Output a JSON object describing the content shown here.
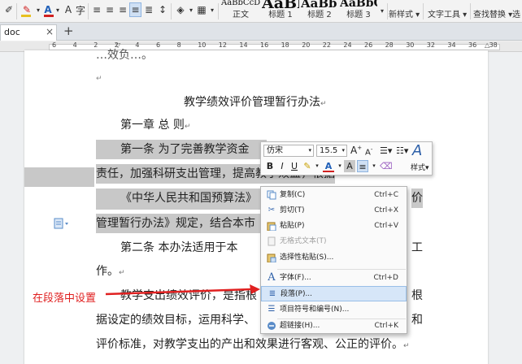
{
  "ribbon": {
    "styles": [
      {
        "preview": "AaBbCcDd",
        "label": "正文"
      },
      {
        "preview": "AaBl",
        "label": "标题 1"
      },
      {
        "preview": "AaBb(",
        "label": "标题 2"
      },
      {
        "preview": "AaBbC",
        "label": "标题 3"
      }
    ],
    "new_style_label": "新样式",
    "text_tools_label": "文字工具",
    "find_replace_label": "查找替换",
    "select_label": "选择",
    "underline_color": "#d02020",
    "font_color": "#1f5fb8"
  },
  "tabbar": {
    "tab_label": "doc",
    "add_label": "+",
    "close_label": "×"
  },
  "ruler": {
    "numbers": [
      "6",
      "4",
      "2",
      "2",
      "4",
      "6",
      "8",
      "10",
      "12",
      "14",
      "16",
      "18",
      "20",
      "22",
      "24",
      "26",
      "28",
      "30",
      "32",
      "34",
      "36",
      "38"
    ]
  },
  "document": {
    "top_partial": "…效负…。",
    "title": "教学绩效评价管理暂行办法",
    "chapter": "第一章    总    则",
    "p1_a": "第一条    为了完善教学资金",
    "p1_b": "责任，加强科研支出管理，提高教学效益，根据",
    "p1_c_left": "《中华人民共和国预算法》",
    "p1_c_right": "价",
    "p1_d": "管理暂行办法》规定，结合本市",
    "p2_a_left": "第二条    本办法适用于本",
    "p2_a_right": "工",
    "p2_b": "作。",
    "p3_a_left": "教学支出绩效评价，是指根",
    "p3_a_right": "根",
    "p3_b_left": "据设定的绩效目标，运用科学、",
    "p3_b_right": "和",
    "p3_c": "评价标准，对教学支出的产出和效果进行客观、公正的评价。",
    "para_mark": "↵",
    "highlight_color": "#c8c8c8"
  },
  "mini_toolbar": {
    "font_name": "仿宋",
    "font_size": "15.5",
    "grow_label": "A",
    "shrink_label": "A",
    "styles_label": "样式",
    "bold": "B",
    "italic": "I",
    "underline": "U",
    "font_color_label": "A",
    "char_shade_label": "A"
  },
  "context_menu": {
    "items": [
      {
        "icon": "copy-icon",
        "label": "复制(C)",
        "shortcut": "Ctrl+C",
        "disabled": false,
        "selected": false
      },
      {
        "icon": "cut-icon",
        "label": "剪切(T)",
        "shortcut": "Ctrl+X",
        "disabled": false,
        "selected": false
      },
      {
        "icon": "paste-icon",
        "label": "粘贴(P)",
        "shortcut": "Ctrl+V",
        "disabled": false,
        "selected": false
      },
      {
        "icon": "plain-text-icon",
        "label": "无格式文本(T)",
        "shortcut": "",
        "disabled": true,
        "selected": false
      },
      {
        "icon": "paste-special-icon",
        "label": "选择性粘贴(S)...",
        "shortcut": "",
        "disabled": false,
        "selected": false
      },
      {
        "icon": "font-icon",
        "label": "字体(F)...",
        "shortcut": "Ctrl+D",
        "disabled": false,
        "selected": false
      },
      {
        "icon": "paragraph-icon",
        "label": "段落(P)...",
        "shortcut": "",
        "disabled": false,
        "selected": true
      },
      {
        "icon": "bullets-icon",
        "label": "项目符号和编号(N)...",
        "shortcut": "",
        "disabled": false,
        "selected": false
      },
      {
        "icon": "hyperlink-icon",
        "label": "超链接(H)...",
        "shortcut": "Ctrl+K",
        "disabled": false,
        "selected": false
      }
    ],
    "selected_color": "#d6e6f8"
  },
  "annotation": {
    "text": "在段落中设置",
    "color": "#e02020"
  }
}
